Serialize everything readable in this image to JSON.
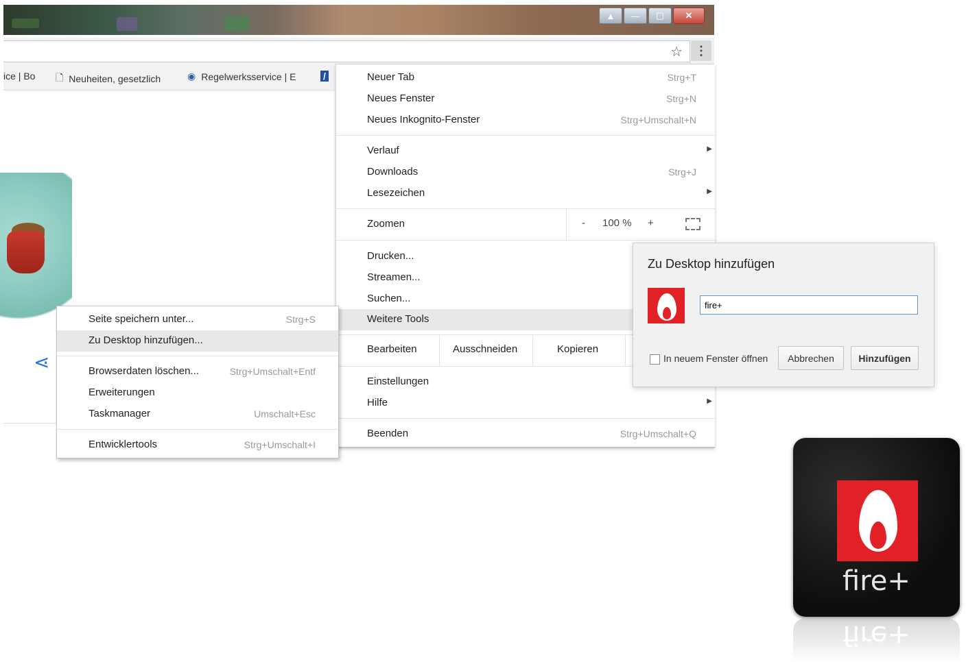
{
  "bookmarks_bar": {
    "item1": "ice | Bo",
    "item2": "Neuheiten, gesetzlich",
    "item3": "Regelwerksservice | E"
  },
  "main_menu": {
    "new_tab": {
      "label": "Neuer Tab",
      "shortcut": "Strg+T"
    },
    "new_window": {
      "label": "Neues Fenster",
      "shortcut": "Strg+N"
    },
    "new_incognito": {
      "label": "Neues Inkognito-Fenster",
      "shortcut": "Strg+Umschalt+N"
    },
    "history": {
      "label": "Verlauf"
    },
    "downloads": {
      "label": "Downloads",
      "shortcut": "Strg+J"
    },
    "bookmarks": {
      "label": "Lesezeichen"
    },
    "zoom": {
      "label": "Zoomen",
      "minus": "-",
      "value": "100 %",
      "plus": "+"
    },
    "print": {
      "label": "Drucken..."
    },
    "cast": {
      "label": "Streamen..."
    },
    "find": {
      "label": "Suchen..."
    },
    "more_tools": {
      "label": "Weitere Tools"
    },
    "edit": {
      "label": "Bearbeiten",
      "cut": "Ausschneiden",
      "copy": "Kopieren"
    },
    "settings": {
      "label": "Einstellungen"
    },
    "help": {
      "label": "Hilfe"
    },
    "exit": {
      "label": "Beenden",
      "shortcut": "Strg+Umschalt+Q"
    }
  },
  "submenu": {
    "save_page": {
      "label": "Seite speichern unter...",
      "shortcut": "Strg+S"
    },
    "add_to_desktop": {
      "label": "Zu Desktop hinzufügen..."
    },
    "clear_data": {
      "label": "Browserdaten löschen...",
      "shortcut": "Strg+Umschalt+Entf"
    },
    "extensions": {
      "label": "Erweiterungen"
    },
    "task_manager": {
      "label": "Taskmanager",
      "shortcut": "Umschalt+Esc"
    },
    "dev_tools": {
      "label": "Entwicklertools",
      "shortcut": "Strg+Umschalt+I"
    }
  },
  "dialog": {
    "title": "Zu Desktop hinzufügen",
    "name_value": "fire+",
    "open_new_window_label": "In neuem Fenster öffnen",
    "cancel_label": "Abbrechen",
    "add_label": "Hinzufügen"
  },
  "desktop_tile": {
    "label": "fire+",
    "reflection": "fire+"
  },
  "colors": {
    "app_red": "#e12125",
    "focus_blue": "#5a9bd6",
    "menu_highlight": "#e8e8e8"
  }
}
